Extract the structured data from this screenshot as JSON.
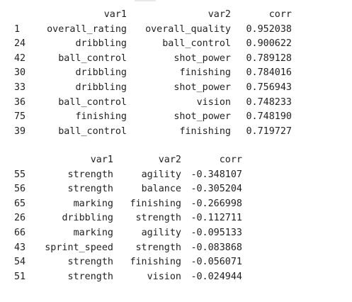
{
  "tables": [
    {
      "columns": [
        "",
        "var1",
        "var2",
        "corr"
      ],
      "rows": [
        {
          "idx": "1",
          "var1": "overall_rating",
          "var2": "overall_quality",
          "corr": "0.952038"
        },
        {
          "idx": "24",
          "var1": "dribbling",
          "var2": "ball_control",
          "corr": "0.900622"
        },
        {
          "idx": "42",
          "var1": "ball_control",
          "var2": "shot_power",
          "corr": "0.789128"
        },
        {
          "idx": "30",
          "var1": "dribbling",
          "var2": "finishing",
          "corr": "0.784016"
        },
        {
          "idx": "33",
          "var1": "dribbling",
          "var2": "shot_power",
          "corr": "0.756943"
        },
        {
          "idx": "36",
          "var1": "ball_control",
          "var2": "vision",
          "corr": "0.748233"
        },
        {
          "idx": "75",
          "var1": "finishing",
          "var2": "shot_power",
          "corr": "0.748190"
        },
        {
          "idx": "39",
          "var1": "ball_control",
          "var2": "finishing",
          "corr": "0.719727"
        }
      ]
    },
    {
      "columns": [
        "",
        "var1",
        "var2",
        "corr"
      ],
      "rows": [
        {
          "idx": "55",
          "var1": "strength",
          "var2": "agility",
          "corr": "-0.348107"
        },
        {
          "idx": "56",
          "var1": "strength",
          "var2": "balance",
          "corr": "-0.305204"
        },
        {
          "idx": "65",
          "var1": "marking",
          "var2": "finishing",
          "corr": "-0.266998"
        },
        {
          "idx": "26",
          "var1": "dribbling",
          "var2": "strength",
          "corr": "-0.112711"
        },
        {
          "idx": "66",
          "var1": "marking",
          "var2": "agility",
          "corr": "-0.095133"
        },
        {
          "idx": "43",
          "var1": "sprint_speed",
          "var2": "strength",
          "corr": "-0.083868"
        },
        {
          "idx": "54",
          "var1": "strength",
          "var2": "finishing",
          "corr": "-0.056071"
        },
        {
          "idx": "51",
          "var1": "strength",
          "var2": "vision",
          "corr": "-0.024944"
        }
      ]
    }
  ]
}
